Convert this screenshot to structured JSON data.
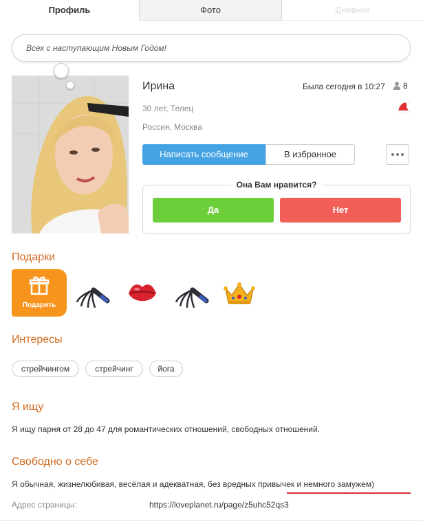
{
  "tabs": [
    {
      "label": "Профиль",
      "active": true
    },
    {
      "label": "Фото",
      "active": false
    },
    {
      "label": "Дневник",
      "active": false,
      "disabled": true
    }
  ],
  "status": {
    "text": "Всех с наступающим Новым Годом!"
  },
  "profile": {
    "name": "Ирина",
    "last_seen": "Была сегодня в 10:27",
    "friends_count": "8",
    "age": "30 лет, Телец",
    "location": "Россия, Москва"
  },
  "actions": {
    "message_label": "Написать сообщение",
    "favorites_label": "В избранное",
    "more_icon": "more-dots-icon"
  },
  "like": {
    "question": "Она Вам нравится?",
    "yes_label": "Да",
    "no_label": "Нет"
  },
  "gifts": {
    "title": "Подарки",
    "give_label": "Подарить",
    "items": [
      "whip-gift",
      "lips-gift",
      "whip-gift",
      "crown-gift"
    ]
  },
  "interests": {
    "title": "Интересы",
    "tags": [
      "стрейчингом",
      "стрейчинг",
      "йога"
    ]
  },
  "seeking": {
    "title": "Я ищу",
    "text": "Я ищу парня от 28 до 47 для романтических отношений, свободных отношений."
  },
  "about": {
    "title": "Свободно о себе",
    "text": "Я обычная, жизнелюбивая, весёлая и адекватная, без вредных привычек и немного замужем)"
  },
  "address": {
    "label": "Адрес страницы:",
    "url": "https://loveplanet.ru/page/z5uhc52qs3"
  },
  "colors": {
    "accent_orange": "#d2691e",
    "message_blue": "#45a3e3",
    "yes_green": "#6dce3c",
    "no_red": "#f25f58",
    "gift_orange": "#f7941e"
  }
}
